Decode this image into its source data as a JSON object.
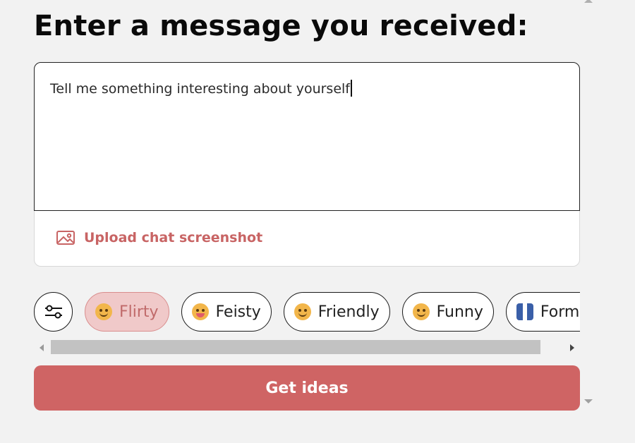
{
  "heading": "Enter a message you received:",
  "message": {
    "value": "Tell me something interesting about yourself"
  },
  "upload": {
    "label": "Upload chat screenshot",
    "icon": "image-icon"
  },
  "tones": [
    {
      "label": "Flirty",
      "icon": "smirk-emoji-icon",
      "selected": true
    },
    {
      "label": "Feisty",
      "icon": "tongue-wink-emoji-icon",
      "selected": false
    },
    {
      "label": "Friendly",
      "icon": "smile-emoji-icon",
      "selected": false
    },
    {
      "label": "Funny",
      "icon": "laugh-emoji-icon",
      "selected": false
    },
    {
      "label": "Forma",
      "icon": "suit-emoji-icon",
      "selected": false
    }
  ],
  "filter_icon": "sliders-icon",
  "cta": {
    "label": "Get ideas"
  },
  "colors": {
    "accent": "#cf6464",
    "chip_selected_bg": "#f0c9c9"
  }
}
